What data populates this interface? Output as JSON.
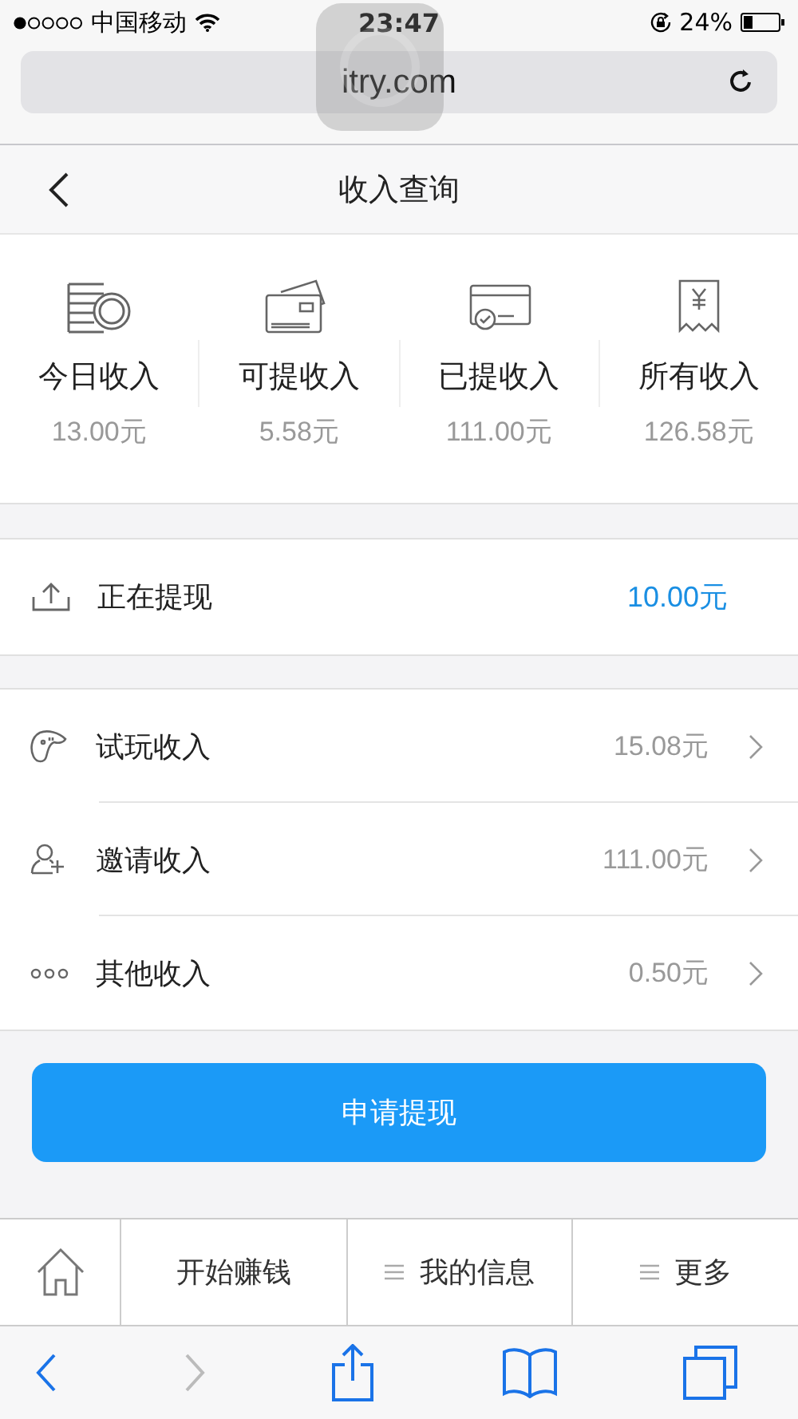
{
  "status_bar": {
    "carrier": "中国移动",
    "time": "23:47",
    "battery": "24%"
  },
  "browser": {
    "url": "itry.com"
  },
  "header": {
    "title": "收入查询"
  },
  "summary": [
    {
      "kind": "coins",
      "label": "今日收入",
      "amount": "13.00元"
    },
    {
      "kind": "cards",
      "label": "可提收入",
      "amount": "5.58元"
    },
    {
      "kind": "card-check",
      "label": "已提收入",
      "amount": "111.00元"
    },
    {
      "kind": "receipt",
      "label": "所有收入",
      "amount": "126.58元"
    }
  ],
  "pending": {
    "label": "正在提现",
    "amount": "10.00元"
  },
  "income_items": [
    {
      "kind": "gamepad",
      "label": "试玩收入",
      "amount": "15.08元"
    },
    {
      "kind": "person-add",
      "label": "邀请收入",
      "amount": "111.00元"
    },
    {
      "kind": "dots",
      "label": "其他收入",
      "amount": "0.50元"
    }
  ],
  "withdraw_button": "申请提现",
  "tab_bar": [
    {
      "kind": "home"
    },
    {
      "kind": "text",
      "label": "开始赚钱"
    },
    {
      "kind": "menu",
      "label": "我的信息"
    },
    {
      "kind": "menu",
      "label": "更多"
    }
  ],
  "toolbar": {
    "back_disabled": false,
    "forward_disabled": true
  }
}
